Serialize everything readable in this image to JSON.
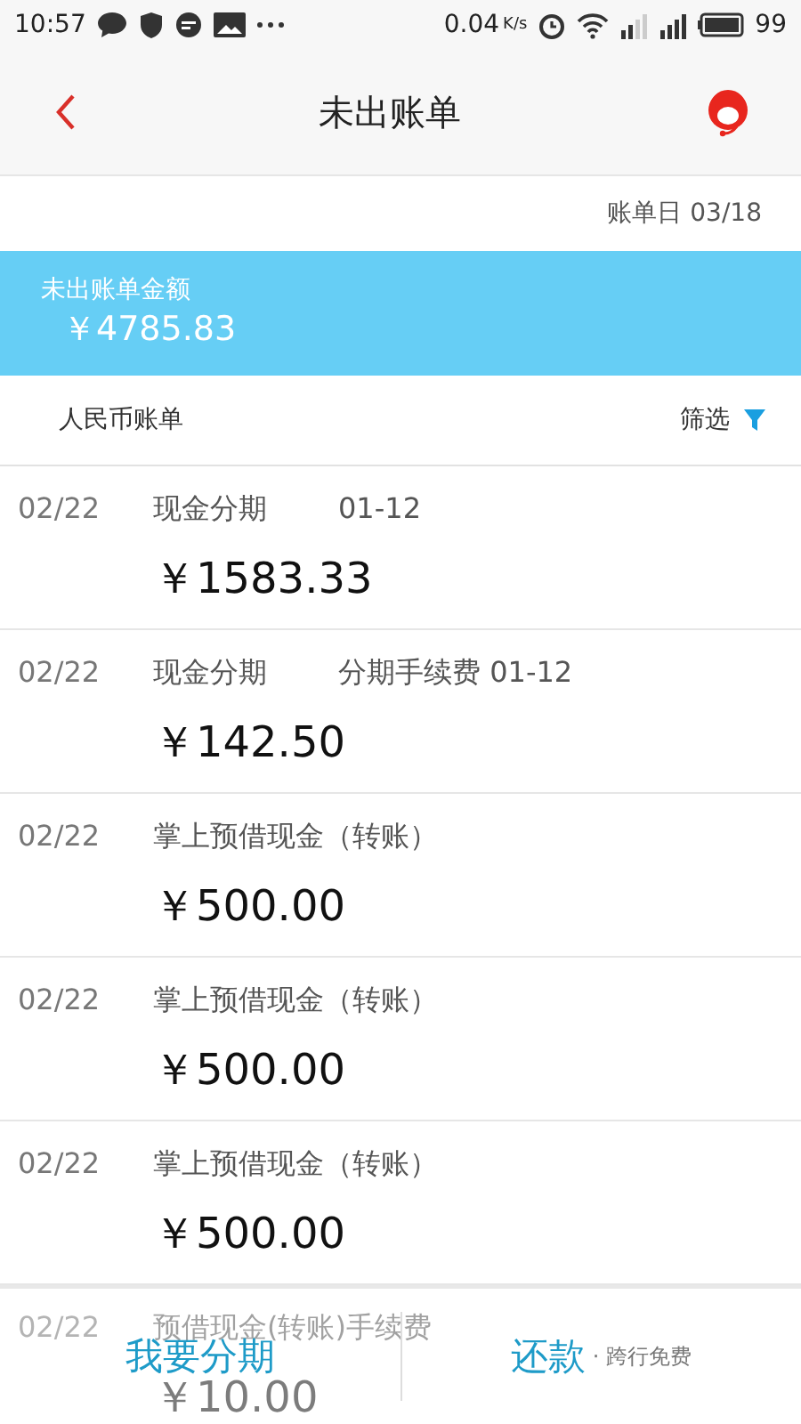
{
  "status_bar": {
    "time": "10:57",
    "speed": "0.04",
    "speed_unit": "K/s",
    "battery": "99"
  },
  "header": {
    "title": "未出账单"
  },
  "bill_day": "账单日 03/18",
  "summary": {
    "label": "未出账单金额",
    "amount": "￥4785.83"
  },
  "currency_bar": {
    "label": "人民币账单",
    "filter": "筛选"
  },
  "transactions": [
    {
      "date": "02/22",
      "title": "现金分期",
      "note": "01-12",
      "amount": "￥1583.33"
    },
    {
      "date": "02/22",
      "title": "现金分期",
      "note": "分期手续费 01-12",
      "amount": "￥142.50"
    },
    {
      "date": "02/22",
      "title": "掌上预借现金（转账）",
      "amount": "￥500.00"
    },
    {
      "date": "02/22",
      "title": "掌上预借现金（转账）",
      "amount": "￥500.00"
    },
    {
      "date": "02/22",
      "title": "掌上预借现金（转账）",
      "amount": "￥500.00"
    },
    {
      "date": "02/22",
      "title": "预借现金(转账)手续费",
      "amount": "￥10.00"
    }
  ],
  "bottom_bar": {
    "installment": "我要分期",
    "repay": "还款",
    "repay_note": "· 跨行免费"
  }
}
